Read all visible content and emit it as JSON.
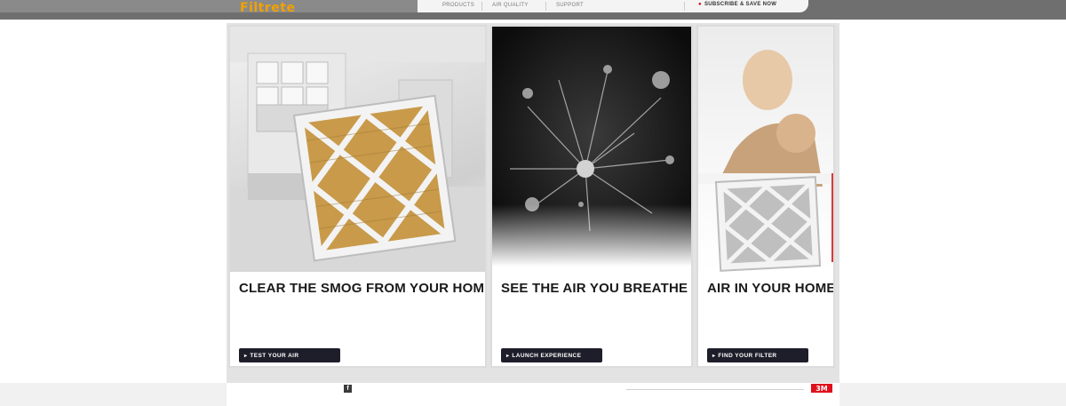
{
  "header": {
    "logo_main": "Filtrete",
    "logo_sub": "",
    "nav": [
      {
        "label": "PRODUCTS"
      },
      {
        "label": "AIR QUALITY"
      },
      {
        "label": "SUPPORT"
      }
    ],
    "cta": {
      "label": "SUBSCRIBE & SAVE NOW",
      "icon": "user-icon"
    }
  },
  "cards": [
    {
      "title": "CLEAR THE SMOG FROM YOUR HOME",
      "subtitle": "",
      "body": "",
      "button": "TEST YOUR AIR"
    },
    {
      "title": "SEE THE AIR YOU BREATHE",
      "subtitle": "",
      "body": "",
      "button": "LAUNCH EXPERIENCE"
    },
    {
      "title": "AIR IN YOUR HOME",
      "subtitle": "",
      "body": "",
      "button": "FIND YOUR FILTER"
    }
  ],
  "footer": {
    "social_label": "",
    "text": "",
    "brand": "3M"
  },
  "colors": {
    "accent": "#f2a100",
    "button_bg": "#1e1e2b",
    "brand_red": "#e0111b"
  }
}
